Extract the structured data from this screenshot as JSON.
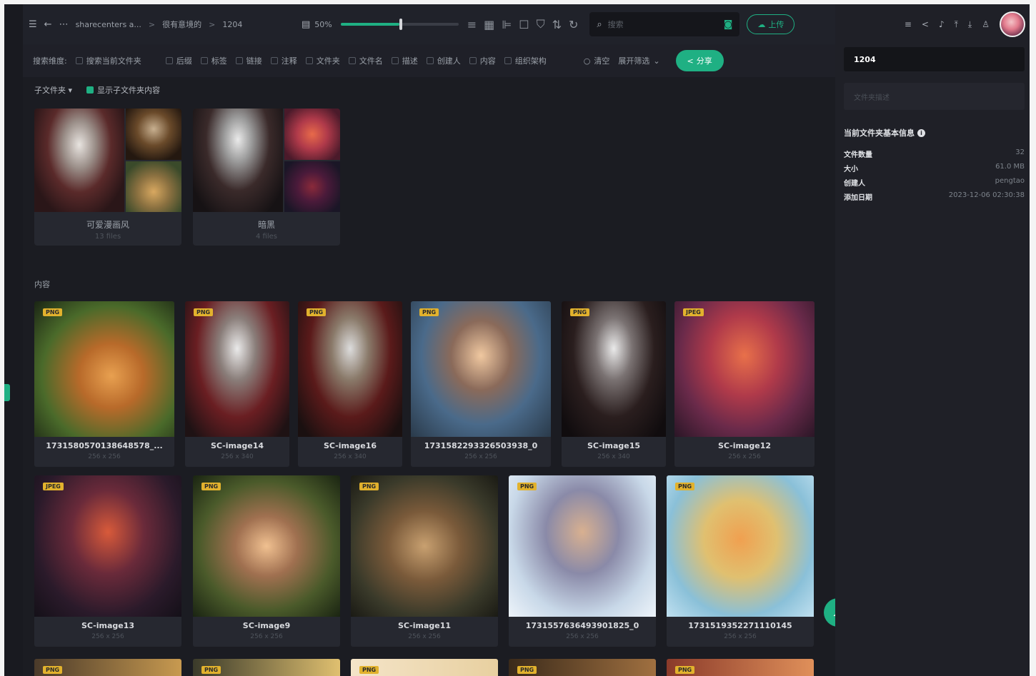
{
  "breadcrumb": {
    "folder": "sharecenters a...",
    "parent": "很有意境的",
    "sep": ">",
    "current": "1204"
  },
  "zoom": {
    "label": "50%",
    "value": 50
  },
  "search": {
    "placeholder": "搜索"
  },
  "upload_label": "上传",
  "filters": {
    "label": "搜索维度:",
    "current_folder": "搜索当前文件夹",
    "options": [
      "后缀",
      "标签",
      "链接",
      "注释",
      "文件夹",
      "文件名",
      "描述",
      "创建人",
      "内容",
      "组织架构"
    ],
    "clear": "清空",
    "expand": "展开筛选",
    "share": "分享"
  },
  "subfolder_menu": "子文件夹",
  "show_sub": "显示子文件夹内容",
  "folders": [
    {
      "name": "可爱漫画风",
      "count": "13 files"
    },
    {
      "name": "暗黑",
      "count": "4 files"
    }
  ],
  "section_label": "内容",
  "colors": {
    "accent": "#1fb083",
    "badge": "#e2b22d",
    "bg": "#1b1c22",
    "card": "#262830"
  },
  "images": [
    {
      "name": "1731580570138648578_...",
      "dim": "256 x 256",
      "type": "PNG"
    },
    {
      "name": "SC-image14",
      "dim": "256 x 340",
      "type": "PNG"
    },
    {
      "name": "SC-image16",
      "dim": "256 x 340",
      "type": "PNG"
    },
    {
      "name": "1731582293326503938_0",
      "dim": "256 x 256",
      "type": "PNG"
    },
    {
      "name": "SC-image15",
      "dim": "256 x 340",
      "type": "PNG"
    },
    {
      "name": "SC-image12",
      "dim": "256 x 256",
      "type": "JPEG"
    },
    {
      "name": "SC-image13",
      "dim": "256 x 256",
      "type": "JPEG"
    },
    {
      "name": "SC-image9",
      "dim": "256 x 256",
      "type": "PNG"
    },
    {
      "name": "SC-image11",
      "dim": "256 x 256",
      "type": "PNG"
    },
    {
      "name": "1731557636493901825_0",
      "dim": "256 x 256",
      "type": "PNG"
    },
    {
      "name": "1731519352271110145",
      "dim": "256 x 256",
      "type": "PNG"
    },
    {
      "name": "",
      "dim": "",
      "type": "PNG"
    },
    {
      "name": "",
      "dim": "",
      "type": "PNG"
    },
    {
      "name": "",
      "dim": "",
      "type": "PNG"
    },
    {
      "name": "",
      "dim": "",
      "type": "PNG"
    },
    {
      "name": "",
      "dim": "",
      "type": "PNG"
    }
  ],
  "panel": {
    "folder_name": "1204",
    "desc_placeholder": "文件夹描述",
    "info_title": "当前文件夹基本信息",
    "rows": [
      {
        "k": "文件数量",
        "v": "32"
      },
      {
        "k": "大小",
        "v": "61.0 MB"
      },
      {
        "k": "创建人",
        "v": "pengtao"
      },
      {
        "k": "添加日期",
        "v": "2023-12-06 02:30:38"
      }
    ]
  }
}
